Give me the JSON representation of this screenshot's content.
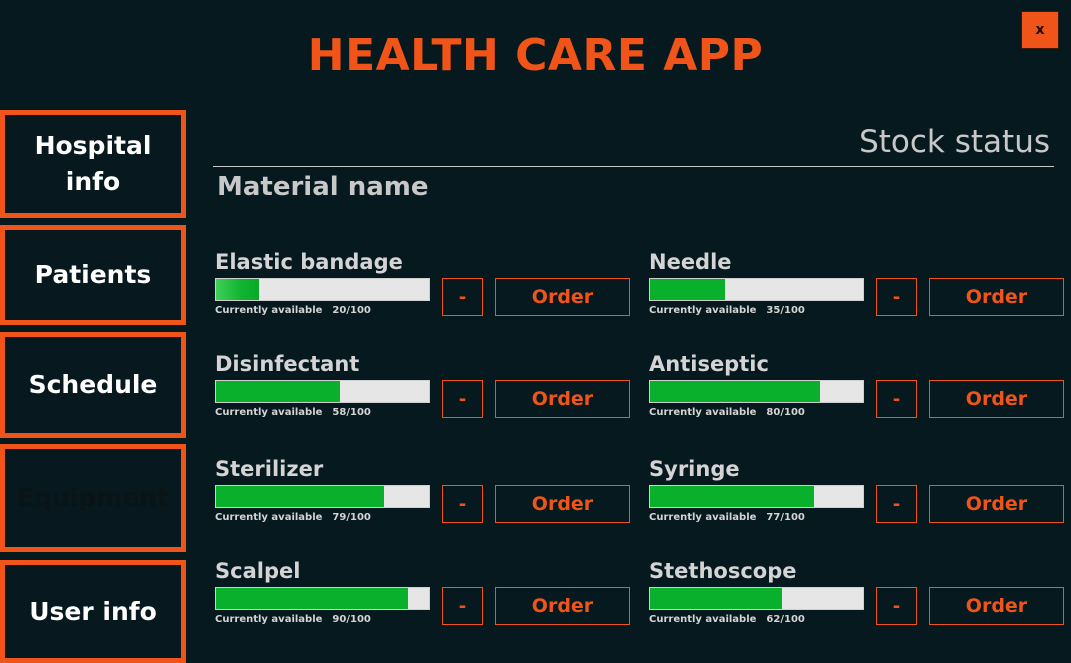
{
  "app": {
    "title": "HEALTH CARE APP",
    "close_label": "x",
    "accent_color": "#f05418",
    "background_color": "#06191f"
  },
  "nav": {
    "items": [
      {
        "label": "Hospital\ninfo",
        "active": false
      },
      {
        "label": "Patients",
        "active": false
      },
      {
        "label": "Schedule",
        "active": false
      },
      {
        "label": "Equipment",
        "active": true
      },
      {
        "label": "User info",
        "active": false
      }
    ]
  },
  "main": {
    "section_title": "Stock status",
    "column_header": "Material name",
    "available_label": "Currently available",
    "minus_label": "-",
    "order_label": "Order",
    "materials": [
      {
        "name": "Elastic bandage",
        "available": 20,
        "max": 100,
        "count_text": "20/100"
      },
      {
        "name": "Needle",
        "available": 35,
        "max": 100,
        "count_text": "35/100"
      },
      {
        "name": "Disinfectant",
        "available": 58,
        "max": 100,
        "count_text": "58/100"
      },
      {
        "name": "Antiseptic",
        "available": 80,
        "max": 100,
        "count_text": "80/100"
      },
      {
        "name": "Sterilizer",
        "available": 79,
        "max": 100,
        "count_text": "79/100"
      },
      {
        "name": "Syringe",
        "available": 77,
        "max": 100,
        "count_text": "77/100"
      },
      {
        "name": "Scalpel",
        "available": 90,
        "max": 100,
        "count_text": "90/100"
      },
      {
        "name": "Stethoscope",
        "available": 62,
        "max": 100,
        "count_text": "62/100"
      }
    ]
  }
}
